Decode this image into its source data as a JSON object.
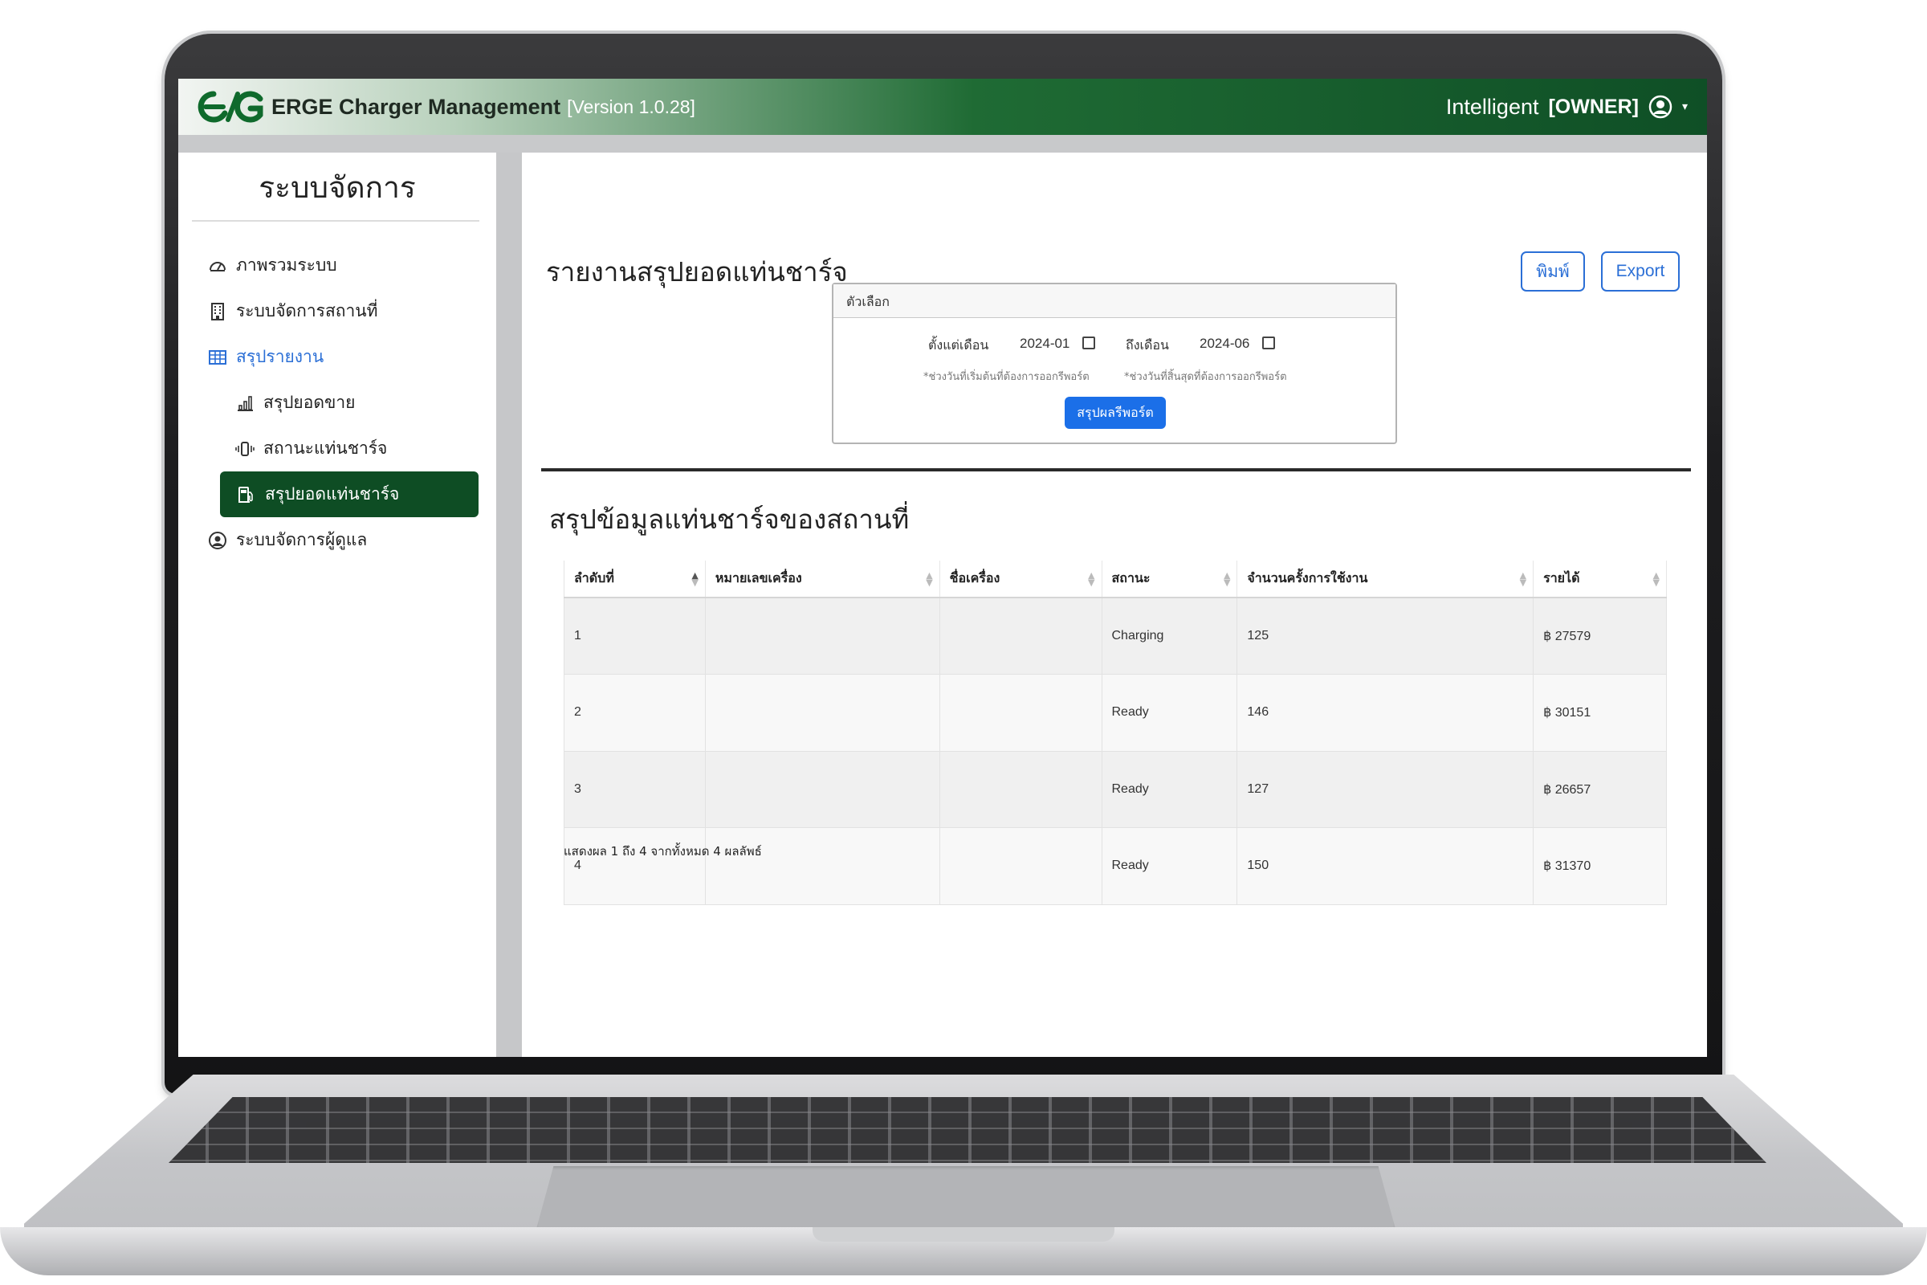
{
  "app": {
    "title": "ERGE Charger Management",
    "version": "[Version 1.0.28]",
    "brand_color": "#0e4d24"
  },
  "user": {
    "name": "Intelligent",
    "role": "[OWNER]"
  },
  "sidebar": {
    "title": "ระบบจัดการ",
    "items": [
      {
        "label": "ภาพรวมระบบ",
        "icon": "dashboard-icon"
      },
      {
        "label": "ระบบจัดการสถานที่",
        "icon": "building-icon"
      },
      {
        "label": "สรุปรายงาน",
        "icon": "table-icon"
      },
      {
        "label": "สรุปยอดขาย",
        "icon": "bar-chart-icon"
      },
      {
        "label": "สถานะแท่นชาร์จ",
        "icon": "vibrate-icon"
      },
      {
        "label": "สรุปยอดแท่นชาร์จ",
        "icon": "fuel-pump-icon"
      },
      {
        "label": "ระบบจัดการผู้ดูแล",
        "icon": "user-circle-icon"
      }
    ]
  },
  "report": {
    "title": "รายงานสรุปยอดแท่นชาร์จ",
    "print_label": "พิมพ์",
    "export_label": "Export"
  },
  "filter": {
    "header": "ตัวเลือก",
    "from_label": "ตั้งแต่เดือน",
    "from_value": "2024-01",
    "to_label": "ถึงเดือน",
    "to_value": "2024-06",
    "from_hint": "*ช่วงวันที่เริ่มต้นที่ต้องการออกรีพอร์ต",
    "to_hint": "*ช่วงวันที่สิ้นสุดที่ต้องการออกรีพอร์ต",
    "submit_label": "สรุปผลรีพอร์ต"
  },
  "summary": {
    "title": "สรุปข้อมูลแท่นชาร์จของสถานที่",
    "columns": [
      "ลำดับที่",
      "หมายเลขเครื่อง",
      "ชื่อเครื่อง",
      "สถานะ",
      "จำนวนครั้งการใช้งาน",
      "รายได้"
    ],
    "rows": [
      {
        "no": "1",
        "serial": "",
        "name": "",
        "status": "Charging",
        "uses": "125",
        "revenue": "฿ 27579"
      },
      {
        "no": "2",
        "serial": "",
        "name": "",
        "status": "Ready",
        "uses": "146",
        "revenue": "฿ 30151"
      },
      {
        "no": "3",
        "serial": "",
        "name": "",
        "status": "Ready",
        "uses": "127",
        "revenue": "฿ 26657"
      },
      {
        "no": "4",
        "serial": "",
        "name": "",
        "status": "Ready",
        "uses": "150",
        "revenue": "฿ 31370"
      }
    ],
    "info": "แสดงผล 1 ถึง 4 จากทั้งหมด 4 ผลลัพธ์",
    "status_colors": {
      "Charging": "#5e8cd8",
      "Ready": "#2e9a36"
    }
  }
}
